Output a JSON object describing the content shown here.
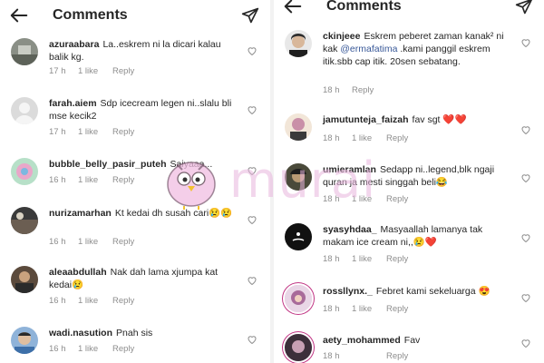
{
  "left": {
    "header": {
      "title": "Comments"
    },
    "comments": [
      {
        "username": "azuraabara",
        "text": "La..eskrem ni la dicari kalau balik kg.",
        "time": "17 h",
        "likes": "1 like",
        "reply": "Reply"
      },
      {
        "username": "farah.aiem",
        "text": "Sdp icecream legen ni..slalu bli mse kecik2",
        "time": "17 h",
        "likes": "1 like",
        "reply": "Reply"
      },
      {
        "username": "bubble_belly_pasir_puteh",
        "text": "Saiyaaa...",
        "time": "16 h",
        "likes": "1 like",
        "reply": "Reply"
      },
      {
        "username": "nurizamarhan",
        "text": "Kt kedai dh susah cari😢😢",
        "time": "16 h",
        "likes": "1 like",
        "reply": "Reply"
      },
      {
        "username": "aleaabdullah",
        "text": "Nak dah lama xjumpa kat kedai😢",
        "time": "16 h",
        "likes": "1 like",
        "reply": "Reply"
      },
      {
        "username": "wadi.nasution",
        "text": "Pnah sis",
        "time": "16 h",
        "likes": "1 like",
        "reply": "Reply"
      }
    ]
  },
  "right": {
    "header": {
      "title": "Comments"
    },
    "comments": [
      {
        "username": "ckinjeee",
        "text_before": "Eskrem peberet zaman kanak² ni kak ",
        "mention": "@ermafatima",
        "text_after": " .kami panggil eskrem itik.sbb cap itik. 20sen sebatang.",
        "time": "18 h",
        "likes": "",
        "reply": "Reply"
      },
      {
        "username": "jamutunteja_faizah",
        "text": "fav sgt ❤️❤️",
        "time": "18 h",
        "likes": "1 like",
        "reply": "Reply"
      },
      {
        "username": "umieramlan",
        "text": "Sedapp ni..legend,blk ngaji quran ja mesti singgah beli😂",
        "time": "18 h",
        "likes": "1 like",
        "reply": "Reply"
      },
      {
        "username": "syasyhdaa_",
        "text": "Masyaallah lamanya tak makam ice cream ni,,😢❤️",
        "time": "18 h",
        "likes": "1 like",
        "reply": "Reply"
      },
      {
        "username": "rossllynx._",
        "text": "Febret kami sekeluarga 😍",
        "time": "18 h",
        "likes": "1 like",
        "reply": "Reply"
      },
      {
        "username": "aety_mohammed",
        "text": "Fav",
        "time": "18 h",
        "likes": "",
        "reply": "Reply"
      }
    ]
  },
  "watermark": {
    "text": "murai"
  },
  "colors": {
    "text": "#262626",
    "meta": "#8e8e8e",
    "mention": "#385898",
    "watermark": "#e7b4dc"
  },
  "icons": [
    "back-arrow-icon",
    "send-icon",
    "heart-outline-icon",
    "avatar-icon"
  ]
}
